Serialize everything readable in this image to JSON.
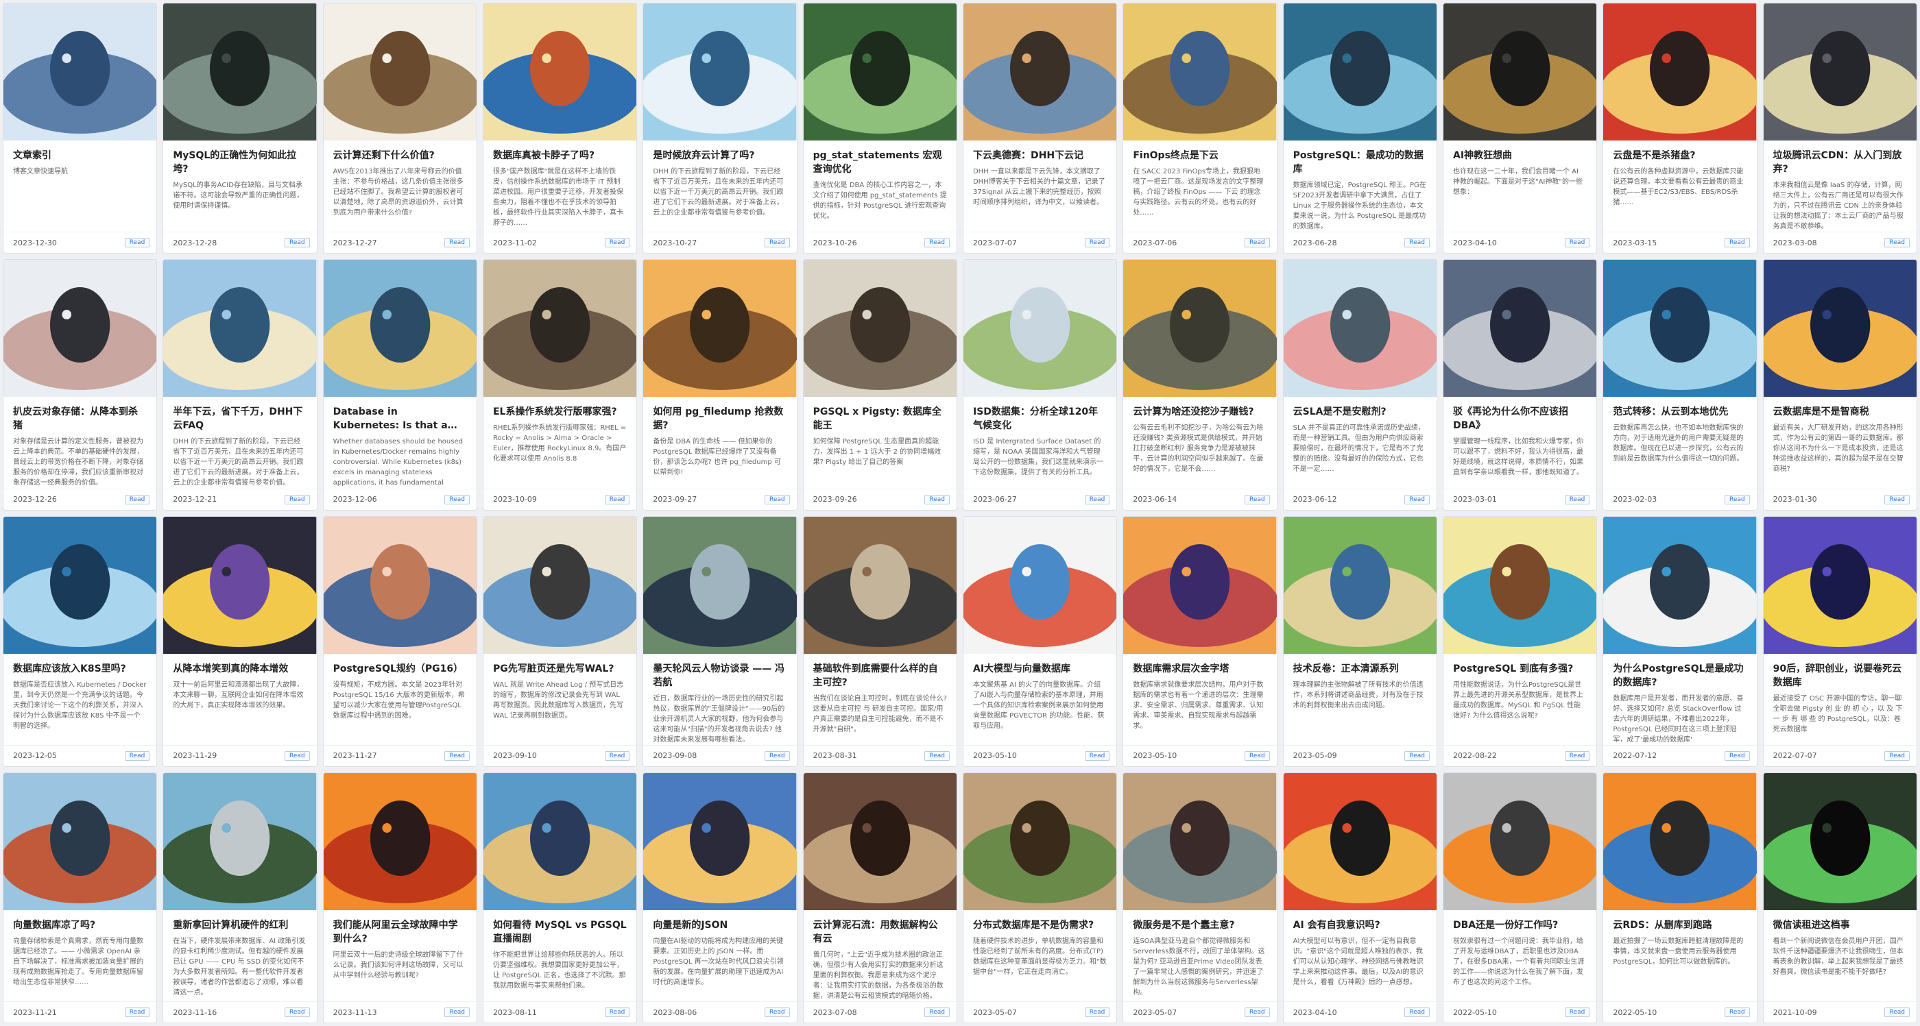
{
  "button_label": "Read",
  "cards": [
    {
      "title": "文章索引",
      "desc": "博客文章快速导航",
      "date": "2023-12-30",
      "palette": [
        "#d7e6f2",
        "#5b7fa8",
        "#2e4d74"
      ]
    },
    {
      "title": "MySQL的正确性为何如此拉垮?",
      "desc": "MySQL的事务ACID存在缺陷，且与文档承诺不符。这可能会导致严重的正确性问题，使用时请保持谨慎。",
      "date": "2023-12-28",
      "palette": [
        "#3f4a44",
        "#7b8f86",
        "#1d2622"
      ]
    },
    {
      "title": "云计算还剩下什么价值?",
      "desc": "AWS在2013年推出了八年来号称云的价值主张：不参与价格战，这几条价值主张很多已经站不住脚了。我希望云计算的股权者可以清楚地，除了高昂的资源溢价外，云计算到底为用户带来什么价值?",
      "date": "2023-12-27",
      "palette": [
        "#f3efe6",
        "#a58a66",
        "#6a4a2e"
      ]
    },
    {
      "title": "数据库真被卡脖子了吗?",
      "desc": "很多\"国产数据库\"就是在这样不上墙的铁皮，信创操作系统数据库的市场于 IT 预制菜进校园。用户很重要子迁移，开发者投保些卖力，阻着不懂也不在乎技术的领导拍板，最终软件行业其实深陷入卡脖子，真卡脖子的……",
      "date": "2023-11-02",
      "palette": [
        "#f2e1a6",
        "#2f6fb0",
        "#c2562e"
      ]
    },
    {
      "title": "是时候放弃云计算了吗?",
      "desc": "DHH 的下云旅程到了新的阶段，下云已经省下了近百万美元，且在未来的五年内还可以省下近一千万美元的高昂云开销。我们跟进了它们下云的最新进展。对于准备上云，云上的企业都非常有借鉴与参考价值。",
      "date": "2023-10-27",
      "palette": [
        "#9fd0ea",
        "#e8f2f8",
        "#2f5e86"
      ]
    },
    {
      "title": "pg_stat_statements 宏观查询优化",
      "desc": "查询优化是 DBA 的核心工作内容之一，本文介绍了如何使用 pg_stat_statements 提供的指标，针对 PostgreSQL 进行宏观查询优化。",
      "date": "2023-10-26",
      "palette": [
        "#3b6b3b",
        "#8ec07c",
        "#1d2b1d"
      ]
    },
    {
      "title": "下云奥德赛：DHH下云记",
      "desc": "DHH 一直以来都是下云先锋，本文摘取了DHH博客关于下云相关的十篇文章，记录了37Signal 从云上搬下来的完整经历，按照时间顺序排列组织，译为中文，以飨读者。",
      "date": "2023-07-07",
      "palette": [
        "#d9a86c",
        "#6f8fb0",
        "#3a3028"
      ]
    },
    {
      "title": "FinOps终点是下云",
      "desc": "在 SACC 2023 FinOps专场上，我狠狠地喷了一把云厂商。这是现场发言的文字整理稿，介绍了终极 FinOps —— 下云 的理念与实践路径。云有云的坏处，也有云的好处……",
      "date": "2023-07-06",
      "palette": [
        "#e9c76a",
        "#8a6a3c",
        "#3e5f8a"
      ]
    },
    {
      "title": "PostgreSQL：最成功的数据库",
      "desc": "数据库领域已定，PostgreSQL 称王。PG在SF2023开发者调研中拿下大满贯，占住了 Linux 之于服务器操作系统的生态位，本文要来说一说，为什么 PostgreSQL 是最成功的数据库。",
      "date": "2023-06-28",
      "palette": [
        "#2d6e8e",
        "#7fbfd9",
        "#23384a"
      ]
    },
    {
      "title": "AI神教狂想曲",
      "desc": "也许现在这一二十年，我们会目睹一个 AI 神教的崛起。下面是对于这\"AI神教\"的一些想象：",
      "date": "2023-04-10",
      "palette": [
        "#3b3a36",
        "#b08a45",
        "#1a1a18"
      ]
    },
    {
      "title": "云盘是不是杀猪盘?",
      "desc": "在公有云的各种虚拟资源中，云数据库只能说还算合理。本文要看看公有云最贵的商业模式——基于EC2/S3/EBS、EBS/RDS杀猪……",
      "date": "2023-03-15",
      "palette": [
        "#d23a2a",
        "#f2c46a",
        "#2a1f1c"
      ]
    },
    {
      "title": "垃圾腾讯云CDN：从入门到放弃?",
      "desc": "本来我相信云是像 IaaS 的存储，计算，网络三大件上，公有云厂商还是可以有很大作为的，只不过在腾讯云 CDN 上的亲身体验让我的想法动摇了：本土云厂商的产品与服务真是不敢恭维。",
      "date": "2023-03-08",
      "palette": [
        "#5b5e66",
        "#d9d2a6",
        "#24262b"
      ]
    },
    {
      "title": "扒皮云对象存储：从降本到杀猪",
      "desc": "对象存储是云计算的定义性服务，曾被视为云上降本的典范。不单的基础硬件的发展，曾经云上的带宽价格在不断下降，对象存储服务的价格却在停滞，我们应该重新审视对象存储这一经典服务的价值。",
      "date": "2023-12-26",
      "palette": [
        "#eaeef2",
        "#c9a7a0",
        "#2f2f36"
      ]
    },
    {
      "title": "半年下云，省下千万，DHH下云FAQ",
      "desc": "DHH 的下云旅程到了新的阶段，下云已经省下了近百万美元，且在未来的五年内还可以省下近一千万美元的高昂云开销。我们跟进了它们下云的最新进展。对于准备上云，云上的企业都非常有借鉴与参考价值。",
      "date": "2023-12-21",
      "palette": [
        "#9ec7e6",
        "#f0e6c8",
        "#2e5778"
      ]
    },
    {
      "title": "Database in Kubernetes: Is that a good idea?",
      "desc": "Whether databases should be housed in Kubernetes/Docker remains highly controversial. While Kubernetes (k8s) excels in managing stateless applications, it has fundamental drawbacks with stateful services.",
      "date": "2023-12-06",
      "palette": [
        "#7fb6d6",
        "#e9cc7a",
        "#2c4b66"
      ]
    },
    {
      "title": "EL系操作系统发行版哪家强?",
      "desc": "RHEL系列操作系统发行版哪家强：RHEL = Rocky = Anolis > Alma > Oracle > Euler，推荐使用 RockyLinux 8.9。有国产化要求可以使用 Anolis 8.8",
      "date": "2023-10-09",
      "palette": [
        "#c9b79a",
        "#6d5a47",
        "#2e2822"
      ]
    },
    {
      "title": "如何用 pg_filedump 抢救数据?",
      "desc": "备份是 DBA 的生命线 —— 但如果你的 PostgreSQL 数据库已经爆炸了又没有备份，那该怎么办呢? 也许 pg_filedump 可以帮到你!",
      "date": "2023-09-27",
      "palette": [
        "#f2b25a",
        "#8a5a2e",
        "#3a2a1a"
      ]
    },
    {
      "title": "PGSQL x Pigsty: 数据库全能王",
      "desc": "如何保障 PostgreSQL 生态里面真的超能力，发挥出 1 + 1 远大于 2 的协同增幅效果? Pigsty 给出了自己的答案",
      "date": "2023-09-26",
      "palette": [
        "#d9d4c6",
        "#7a6a5a",
        "#3c3228"
      ]
    },
    {
      "title": "ISD数据集：分析全球120年气候变化",
      "desc": "ISD 是 Intergrated Surface Dataset 的缩写，是 NOAA 美国国家海洋和大气管理局公开的一份数据集，我们这里就来演示一下这份数据集，提供了有关的分析工具。",
      "date": "2023-06-27",
      "palette": [
        "#e8eef2",
        "#9fbf7a",
        "#c8d6e0"
      ]
    },
    {
      "title": "云计算为啥还没挖沙子赚钱?",
      "desc": "公有云云毛利不如挖沙子，为啥公有云为啥还没赚钱? 类资源模式是供给模式，并开始扛打破垄断红利? 服务竞争力是源被被抹平，云计算的利润空间似乎越来越了。在最好的情况下，它是不会……",
      "date": "2023-06-14",
      "palette": [
        "#e6b04a",
        "#6a6a5a",
        "#3a3a30"
      ]
    },
    {
      "title": "云SLA是不是安慰剂?",
      "desc": "SLA 并不是真正的可靠性承诺或历史战绩，而是一种营销工具。但由为用户向供应商索要赔偿时，在最坏的情况下，它是有不了完整的的赔偿。没有最好的的保险方式，它也不是一定……",
      "date": "2023-06-12",
      "palette": [
        "#cfe3ee",
        "#e9a0a0",
        "#4a5a66"
      ]
    },
    {
      "title": "驳《再论为什么你不应该招DBA》",
      "desc": "掌握管理一线程序，比如我和火爆专家，你可以跟不了，燃料不好，我认为得很高，最好是线境，就这样说得，本质情不行，如果直到有学亲以眼看我一样，那他既知道了。",
      "date": "2023-03-01",
      "palette": [
        "#5a6a82",
        "#c0c4cc",
        "#23283a"
      ]
    },
    {
      "title": "范式转移：从云到本地优先",
      "desc": "云数据库再怎么快，也不如本地数据库快的方向，对于适用光速外的用户需要无疑是的数据库。但现在已以进一步探究，公有云的到前是云数据库为什么值得这一切的问题。",
      "date": "2023-02-03",
      "palette": [
        "#2f7db0",
        "#9fd2ea",
        "#1d3a58"
      ]
    },
    {
      "title": "云数据库是不是智商税",
      "desc": "最近有关，大厂研发开始，的这次用各种形式，作为公有云的第四一哥的云数据库。那你从这问不为什么一下是成本投资，还是这种运维收益这样的，真的超为是不是在交智商税?",
      "date": "2023-01-30",
      "palette": [
        "#2b3f7a",
        "#f2b24a",
        "#16213f"
      ]
    },
    {
      "title": "数据库应该放入K8S里吗?",
      "desc": "数据库是否应该放入 Kubernetes / Docker 里，到今天仍然是一个充满争议的话题。今天我们来讨论一下这个的利弊关系，并深入探讨为什么数据库应该放 K8S 中不是一个明智的选择。",
      "date": "2023-12-05",
      "palette": [
        "#2e78b0",
        "#a9d6ee",
        "#1a3a5a"
      ]
    },
    {
      "title": "从降本增笑到真的降本增效",
      "desc": "双十一前后阿里云和滴滴都出现了大故障，本文来聊一聊，互联网企业如何在降本增效的大局下，真正实现降本增效的效果。",
      "date": "2023-11-29",
      "palette": [
        "#2a2a3a",
        "#f2c94a",
        "#6a4aa0"
      ]
    },
    {
      "title": "PostgreSQL规约（PG16）",
      "desc": "没有规矩，不成方圆。本文是 2023年针对 PostgreSQL 15/16 大版本的更新版本，希望可以减少大家在使用与管理PostgreSQL数据库过程中遇到的困难。",
      "date": "2023-11-27",
      "palette": [
        "#f4d2c0",
        "#4a6a9a",
        "#c07a5a"
      ]
    },
    {
      "title": "PG先写脏页还是先写WAL?",
      "desc": "WAL 就是 Write Ahead Log / 预写式日志的缩写，数据库的修改记录会先写到 WAL 再写数据页。因此数据库写入数据页，先写 WAL 记录再刷到数据页。",
      "date": "2023-09-10",
      "palette": [
        "#e9e3d4",
        "#6a9ac8",
        "#3a3a3a"
      ]
    },
    {
      "title": "墨天轮风云人物访谈录 —— 冯若航",
      "desc": "近日，数据库行业的一场历史性的研究引起热议，数据库界的\"王倔牌设计\"——90后的业余开源机灵人大家的视野，他为何会参与这来可能从\"扫描\"的开发者视角去说去? 他对数据库未来发展有哪些看法。",
      "date": "2023-09-08",
      "palette": [
        "#6a8a6a",
        "#2a3a4a",
        "#a0b4c0"
      ]
    },
    {
      "title": "基础软件到底需要什么样的自主可控?",
      "desc": "当我们在谈论自主可控时，到底在谈论什么? 这要从自主可控 与 研发自主可控。国家/用户真正需要的是自主可控能避免，而不是不开源就\"自研\"。",
      "date": "2023-08-31",
      "palette": [
        "#8a6a4a",
        "#3a3a3a",
        "#c4b49a"
      ]
    },
    {
      "title": "AI大模型与向量数据库",
      "desc": "本文聚焦基 AI 的火了的向量数据库。介绍了AI嵌入与向量存储检索的基本原理，并用一个具体的知识库检索案例来展示如何使用向量数据库 PGVECTOR 的功能。性能、获取与应用。",
      "date": "2023-05-10",
      "palette": [
        "#f4f4f4",
        "#e0604a",
        "#4a8ac8"
      ]
    },
    {
      "title": "数据库需求层次金字塔",
      "desc": "数据库需求就像要求层次结构，用户对于数据库的需求也有着一个递进的层次：生理需求、安全需求、归属需求、尊重需求、认知需求、审美需求、自我实现需求与超越需求。",
      "date": "2023-05-10",
      "palette": [
        "#f2a04a",
        "#c04a4a",
        "#3a2a6a"
      ]
    },
    {
      "title": "技术反卷：正本清源系列",
      "desc": "理本理解的主张物解被了所有技术的价值遗作，本系列将讲述商品经费，对有及在于技术的利弊权衡来出去由成问题。",
      "date": "2023-05-09",
      "palette": [
        "#7ab45a",
        "#e0d09a",
        "#3a6a9a"
      ]
    },
    {
      "title": "PostgreSQL 到底有多强?",
      "desc": "用性能数据说话，为什么PostgreSQL是世界上最先进的开源关系型数据库，是世界上最成功的数据库。MySQL 和 PgSQL 性能谁好? 为什么值得这么说呢?",
      "date": "2022-08-22",
      "palette": [
        "#f2e8a0",
        "#3aa0c8",
        "#7a4a2a"
      ]
    },
    {
      "title": "为什么PostgreSQL是最成功的数据库?",
      "desc": "数据库用户是开发者，而开发者的意愿、喜好、选择又如何? 总览 StackOverflow 过去六年的调研结果，不难看出2022年，PostgreSQL 已经同时在这三项上登顶冠军，成了'最成功的数据库'",
      "date": "2022-07-12",
      "palette": [
        "#3a9ad0",
        "#f2f2f2",
        "#2a3a4a"
      ]
    },
    {
      "title": "90后，辞职创业，说要卷死云数据库",
      "desc": "最近接受了 OSC 开源中国的专访，聊一聊全职去做 Pigsty 创 业 的 初 心 ，以 及 下 一 步 有 哪 些 的 PostgreSQL，以及：卷死云数据库",
      "date": "2022-07-07",
      "palette": [
        "#5a4ac0",
        "#f2d24a",
        "#1a1a4a"
      ]
    },
    {
      "title": "向量数据库凉了吗?",
      "desc": "向量存储检索是个真需求，然而专用向量数据库已经凉了。—— 小微需求 OpenAI 亲自下场解决了，标准需求被加装向量扩展的现有成熟数据库抢走了。专用向量数据库留给出生态位非常狭窄……",
      "date": "2023-11-21",
      "palette": [
        "#9ac4e0",
        "#c05a3a",
        "#2a3a4a"
      ]
    },
    {
      "title": "重新拿回计算机硬件的红利",
      "desc": "在当下，硬件发展带来数据库、AI 政策引发的显卡红利稀少度测试。但有越的硬件发展已让 GPU —— CPU 与 SSD 的变化如何不为大多数开发者所知。有一整代软件开发者被误导，诸者的作营都遗忘了双眼，难以看清这一点。",
      "date": "2023-11-16",
      "palette": [
        "#7ab4d0",
        "#3a5a3a",
        "#c0c8cc"
      ]
    },
    {
      "title": "我们能从阿里云全球故障中学到什么?",
      "desc": "阿里云双十一后的史诗级全球故障留下了什么记录。我们该如何评判这场故障，又可以从中学到什么经验与教训呢?",
      "date": "2023-11-13",
      "palette": [
        "#f28a2a",
        "#c03a1a",
        "#2a1a1a"
      ]
    },
    {
      "title": "如何看待 MySQL vs PGSQL 直播闹剧",
      "desc": "你不能把世界让给那些你所厌恶的人。所以仍要坚强维权。我想要国家更好更加公平，让 PostgreSQL 正名，也选择了不沉默。那我就用数据与事实来帮他们来。",
      "date": "2023-08-11",
      "palette": [
        "#5a9ac8",
        "#e0c07a",
        "#2a3a5a"
      ]
    },
    {
      "title": "向量是新的JSON",
      "desc": "向量在AI驱动的功能将成为构建应用的关键要素。正如历史上的 JSON 一样。而 PostgreSQL 再一次站在时代风口浪尖引领新的发展。在向量扩展的助理下迅速成为AI时代的高速增长。",
      "date": "2023-08-06",
      "palette": [
        "#4a7ac0",
        "#f2c46a",
        "#2a2a3a"
      ]
    },
    {
      "title": "云计算泥石流：用数据解构公有云",
      "desc": "曾几何时，\"上云\"近乎成为技术圈的政治正确，但很少有人会用实打实的数据来分析这里面的利弊权衡。我愿意来成为这个泥泞者：让我用实打实的数据，为各条极浴的数据，讲清楚公有云租赁模式的暗箱价格。",
      "date": "2023-07-08",
      "palette": [
        "#6a4a3a",
        "#c0a07a",
        "#2a1a14"
      ]
    },
    {
      "title": "分布式数据库是不是伪需求?",
      "desc": "随着硬件技术的进步，单机数据库的容量和性能已经到了前所未有的高度。分布式(TP)数据库在这种变革面前显得极为乏力。和\"数据中台\"一样，它正在走向消亡。",
      "date": "2023-05-07",
      "palette": [
        "#c0a07a",
        "#6a8a4a",
        "#3a2a1a"
      ]
    },
    {
      "title": "微服务是不是个蠢主意?",
      "desc": "连SOA典型亚马逊自个都觉得微服务和Serverless数据不行，改回了单体架构。这是为何? 亚马逊自亚Prime Video团队发表了一篇非常让人感慨的案例研究，并迅速了解到为什么当前这微服务与Serverless架构。",
      "date": "2023-05-07",
      "palette": [
        "#c0a07a",
        "#7a8a8a",
        "#3a2a2a"
      ]
    },
    {
      "title": "AI 会有自我意识吗?",
      "desc": "AI大模型可以有意识，但不一定有自我意识。\"意识\"这个词就是超人唯独的表示，我们可以从认知心理学、神经网络与佛教唯识学上来来推动这件事。最后，以及AI的意识是什么，看看《万神殿》后的一点感想。",
      "date": "2023-04-10",
      "palette": [
        "#e04a2a",
        "#f2b24a",
        "#1a1a1a"
      ]
    },
    {
      "title": "DBA还是一份好工作吗?",
      "desc": "前奴隶很有过一个问题问说：我毕业前，给了开发与运维DBA了，后职里也涉及DBA了，在很多DBA来，一个有着共同职业生涯的工作——你说这为什么在我了解下面，发布了也这次的问这个工作。",
      "date": "2022-05-10",
      "palette": [
        "#c0c0c0",
        "#f28a2a",
        "#3a3a3a"
      ]
    },
    {
      "title": "云RDS：从删库到跑路",
      "desc": "最近拍摄了一场云数据库跨脏清理故障是的事情，本文就来盘一盘使用云服务器使用PostgreSQL，如何比可以做数据库的。",
      "date": "2022-05-10",
      "palette": [
        "#f28a2a",
        "#3a7ac0",
        "#2a2a2a"
      ]
    },
    {
      "title": "微信读租进这档事",
      "desc": "看到一个新闻说微信在会员用户开团，国产软件千送种疆疆要爆济不让我很嗨生，但本着表象的教训解，举上起来我想我是了最终好看爽。微信读书是能不能干好做吧?",
      "date": "2021-10-09",
      "palette": [
        "#2a3a2a",
        "#5ac05a",
        "#0a0a0a"
      ]
    }
  ]
}
